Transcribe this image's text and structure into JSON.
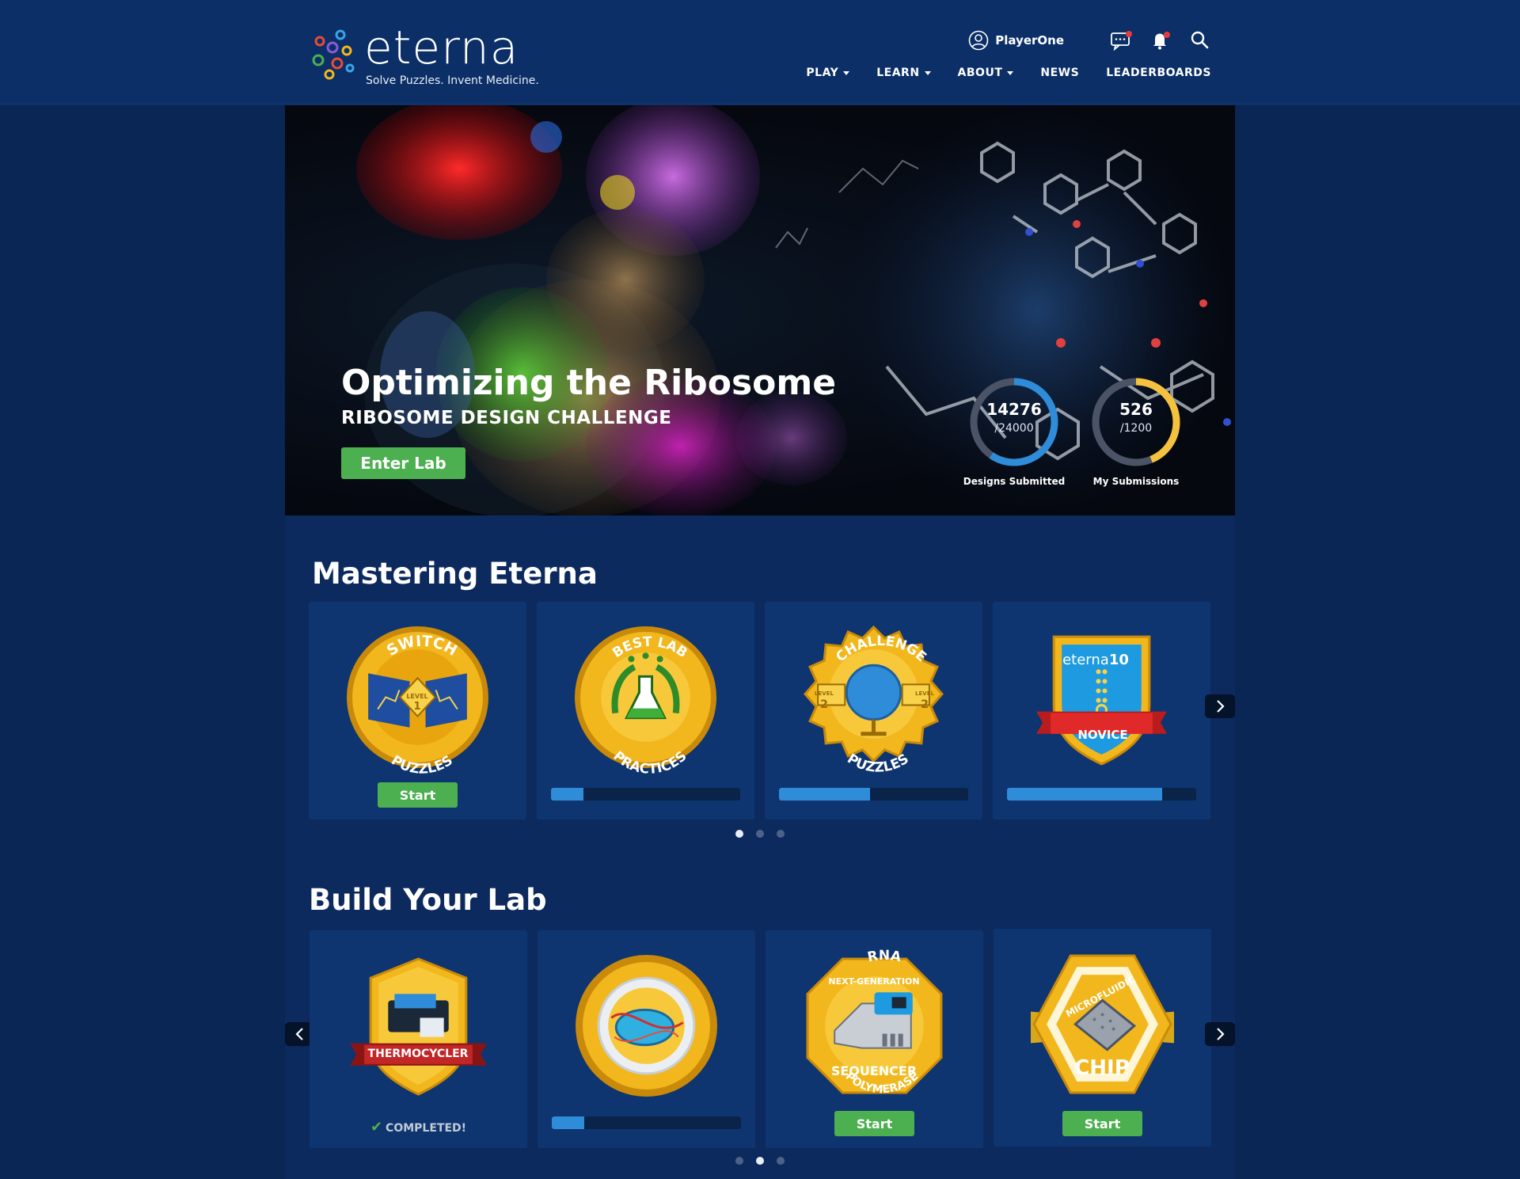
{
  "brand": {
    "name": "eterna",
    "tagline": "Solve Puzzles. Invent Medicine."
  },
  "user": {
    "name": "PlayerOne"
  },
  "nav": [
    {
      "label": "PLAY",
      "dropdown": true
    },
    {
      "label": "LEARN",
      "dropdown": true
    },
    {
      "label": "ABOUT",
      "dropdown": true
    },
    {
      "label": "NEWS",
      "dropdown": false
    },
    {
      "label": "LEADERBOARDS",
      "dropdown": false
    }
  ],
  "hero": {
    "title": "Optimizing the Ribosome",
    "subtitle": "RIBOSOME DESIGN CHALLENGE",
    "button": "Enter Lab",
    "stats": [
      {
        "value": "14276",
        "total": "/24000",
        "label": "Designs Submitted",
        "fraction": 0.595,
        "color": "#2f8cd8"
      },
      {
        "value": "526",
        "total": "/1200",
        "label": "My Submissions",
        "fraction": 0.438,
        "color": "#f6c23e"
      }
    ]
  },
  "mastering": {
    "title": "Mastering Eterna",
    "cards": [
      {
        "badge": "switch-puzzles-badge",
        "top": "SWITCH",
        "bottom": "PUZZLES",
        "level": "LEVEL",
        "level_num": "1",
        "action": "Start"
      },
      {
        "badge": "best-lab-practices-badge",
        "top": "BEST LAB",
        "bottom": "PRACTICES",
        "progress": 0.17
      },
      {
        "badge": "challenge-puzzles-badge",
        "top": "CHALLENGE",
        "bottom": "PUZZLES",
        "level": "LEVEL",
        "level_num": "2",
        "progress": 0.48
      },
      {
        "badge": "eterna10-novice-badge",
        "top": "eterna",
        "top2": "10",
        "bottom": "NOVICE",
        "progress": 0.82
      }
    ],
    "page": 0,
    "pages": 3
  },
  "lab": {
    "title": "Build Your Lab",
    "cards": [
      {
        "badge": "thermocycler-badge",
        "label": "THERMOCYCLER",
        "status": "COMPLETED!"
      },
      {
        "badge": "rna-polymerase-badge",
        "top": "RNA",
        "bottom": "POLYMERASE",
        "progress": 0.17
      },
      {
        "badge": "sequencer-badge",
        "top": "NEXT-GENERATION",
        "bottom": "SEQUENCER",
        "action": "Start"
      },
      {
        "badge": "microfluidic-chip-badge",
        "top": "MICROFLUIDIC",
        "bottom": "CHIP",
        "action": "Start"
      }
    ],
    "page": 1,
    "pages": 3
  },
  "colors": {
    "header": "#0b2f66",
    "panel": "#0c2a5e",
    "card": "#0e3570",
    "green": "#4caf50",
    "progress": "#2f8cd8",
    "gold": "#f2b71c"
  }
}
